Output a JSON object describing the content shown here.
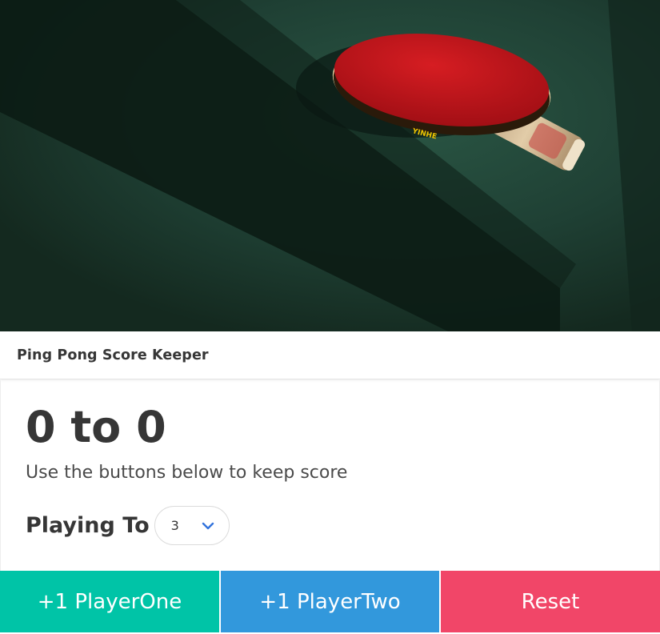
{
  "header": {
    "title": "Ping Pong Score Keeper"
  },
  "scoreboard": {
    "score_text": "0 to 0",
    "player_one_score": 0,
    "player_two_score": 0,
    "subtitle": "Use the buttons below to keep score"
  },
  "playing_to": {
    "label": "Playing To",
    "selected_value": "3",
    "icon": "chevron-down-icon"
  },
  "actions": {
    "player_one_label": "+1 PlayerOne",
    "player_two_label": "+1 PlayerTwo",
    "reset_label": "Reset"
  },
  "hero_image": {
    "paddle_text": "YINHE"
  },
  "colors": {
    "player_one": "#00c4a7",
    "player_two": "#3298dc",
    "reset": "#f14668",
    "text_dark": "#363636",
    "text_muted": "#4a4a4a",
    "chevron": "#3273dc",
    "table_green": "#1f4034",
    "paddle_red": "#c1121a"
  }
}
